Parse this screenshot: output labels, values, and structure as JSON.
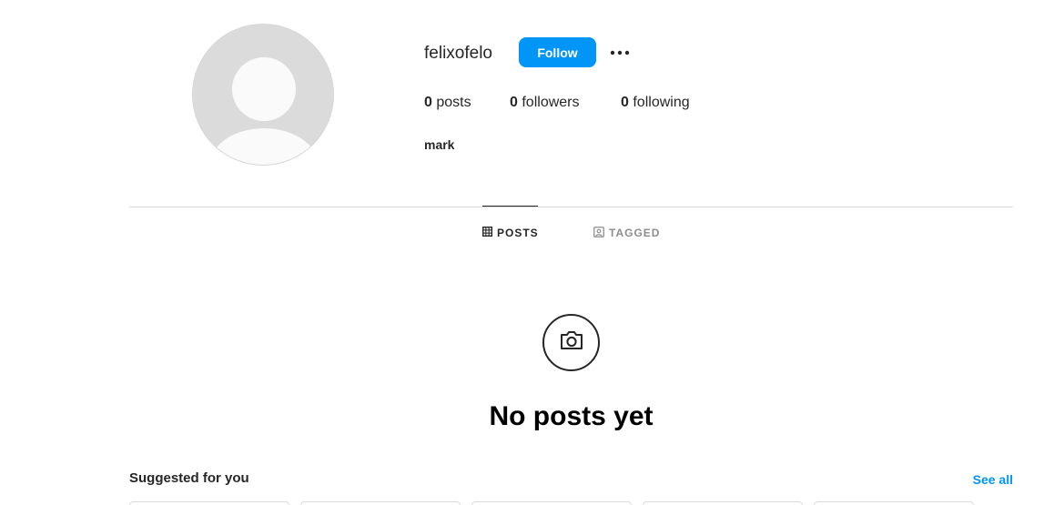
{
  "profile": {
    "username": "felixofelo",
    "follow_label": "Follow",
    "more_icon": "more-horizontal-icon",
    "bio_name": "mark"
  },
  "stats": {
    "posts_count": "0",
    "posts_label": "posts",
    "followers_count": "0",
    "followers_label": "followers",
    "following_count": "0",
    "following_label": "following"
  },
  "tabs": [
    {
      "label": "POSTS",
      "icon": "grid-icon",
      "active": true
    },
    {
      "label": "TAGGED",
      "icon": "tagged-icon",
      "active": false
    }
  ],
  "empty_state": {
    "icon": "camera-icon",
    "title": "No posts yet"
  },
  "suggested": {
    "title": "Suggested for you",
    "see_all_label": "See all"
  },
  "colors": {
    "accent": "#0095f6",
    "divider": "#dbdbdb",
    "text": "#262626",
    "muted": "#8e8e8e"
  }
}
